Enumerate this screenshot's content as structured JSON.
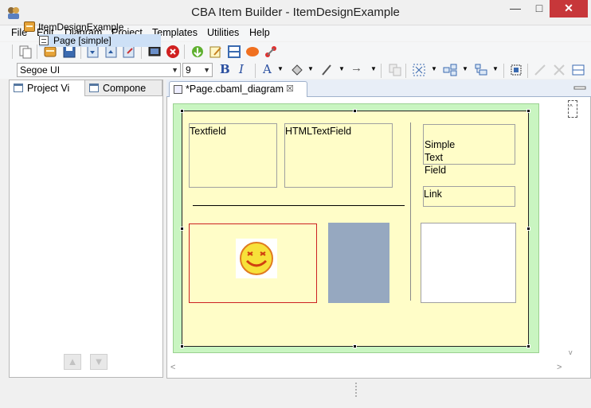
{
  "window": {
    "title": "CBA Item Builder - ItemDesignExample",
    "minimize": "—",
    "maximize": "□",
    "close": "✕"
  },
  "menu": {
    "items": [
      {
        "label": "File",
        "key": "F"
      },
      {
        "label": "Edit",
        "key": "E"
      },
      {
        "label": "Diagram",
        "key": "D"
      },
      {
        "label": "Project",
        "key": "P"
      },
      {
        "label": "Templates",
        "key": "T"
      },
      {
        "label": "Utilities",
        "key": "U"
      },
      {
        "label": "Help",
        "key": "H"
      }
    ]
  },
  "format_toolbar": {
    "font_family": "Segoe UI",
    "font_size": "9",
    "bold": "B",
    "italic": "I",
    "font_color": "A",
    "line_arrow": "→"
  },
  "left_panel": {
    "tabs": [
      "Project Vi",
      "Compone"
    ],
    "tree": {
      "root": "ItemDesignExample",
      "child": "Page [simple]"
    },
    "nav_up": "▲",
    "nav_down": "▼"
  },
  "editor": {
    "tab_label": "*Page.cbaml_diagram",
    "tab_close": "☒"
  },
  "canvas": {
    "textfield_label": "Textfield",
    "htmltextfield_label": "HTMLTextField",
    "simple_text_field_label": "Simple\nText\nField",
    "link_label": "Link",
    "colors": {
      "diagram_bg": "#c9f5c1",
      "page_bg": "#fffdc8",
      "image_border": "#cc2222",
      "panel_fill": "#96a8c0"
    }
  }
}
